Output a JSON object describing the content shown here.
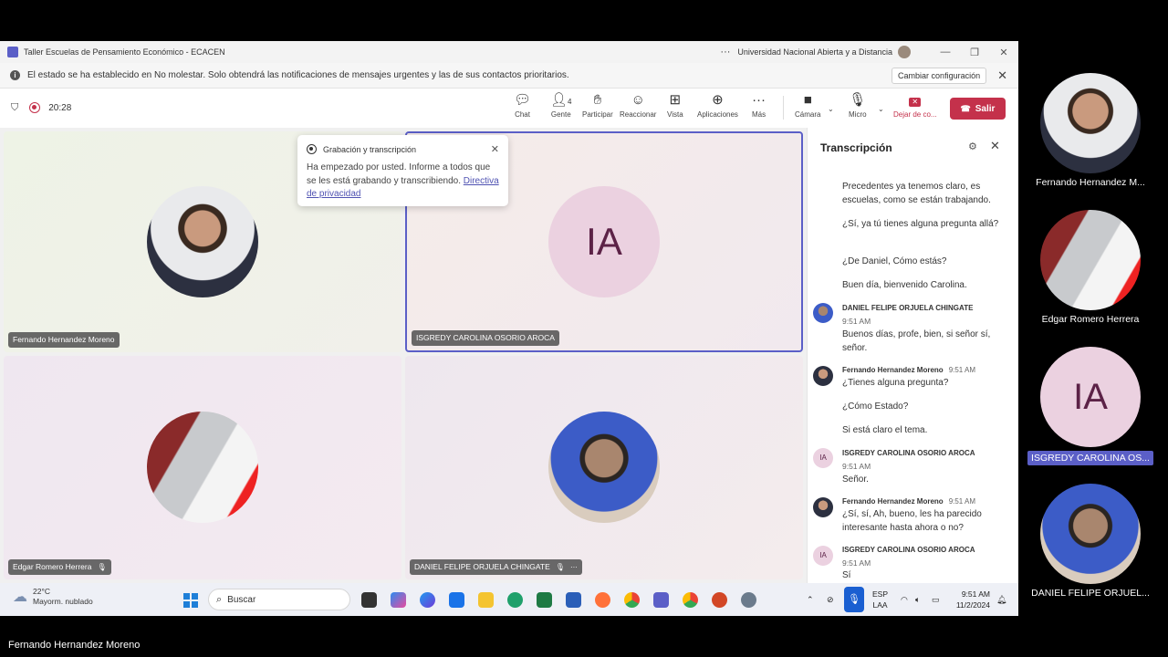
{
  "window": {
    "title": "Taller Escuelas de Pensamiento Económico - ECACEN",
    "org": "Universidad Nacional Abierta y a Distancia",
    "more": "···",
    "min": "—",
    "restore": "❐",
    "close": "✕"
  },
  "banner": {
    "message": "El estado se ha establecido en No molestar. Solo obtendrá las notificaciones de mensajes urgentes y las de sus contactos prioritarios.",
    "change_button": "Cambiar configuración",
    "close": "✕"
  },
  "toolbar": {
    "timer": "20:28",
    "chat": "Chat",
    "people": "Gente",
    "people_count": "4",
    "raise": "Participar",
    "react": "Reaccionar",
    "view": "Vista",
    "apps": "Aplicaciones",
    "more": "Más",
    "camera": "Cámara",
    "mic": "Micro",
    "share": "Dejar de co...",
    "leave": "Salir"
  },
  "tiles": [
    {
      "name": "Fernando Hernandez Moreno"
    },
    {
      "name": "ISGREDY CAROLINA OSORIO AROCA",
      "initials": "IA"
    },
    {
      "name": "Edgar Romero Herrera"
    },
    {
      "name": "DANIEL FELIPE ORJUELA CHINGATE"
    }
  ],
  "popup": {
    "title": "Grabación y transcripción",
    "body": "Ha empezado por usted. Informe a todos que se les está grabando y transcribiendo.",
    "link": "Directiva de privacidad"
  },
  "transcript": {
    "title": "Transcripción",
    "lines": [
      {
        "text": "Precedentes ya tenemos claro, es escuelas, como se están trabajando."
      },
      {
        "text": "¿Sí, ya tú tienes alguna pregunta allá?"
      },
      {
        "text": "¿De Daniel, Cómo estás?"
      },
      {
        "text": "Buen día, bienvenido Carolina."
      }
    ],
    "entries": [
      {
        "speaker": "DANIEL FELIPE ORJUELA CHINGATE",
        "time": "9:51 AM",
        "text": "Buenos días, profe, bien, si señor sí, señor."
      },
      {
        "speaker": "Fernando Hernandez Moreno",
        "time": "9:51 AM",
        "text": "¿Tienes alguna pregunta?",
        "extra1": "¿Cómo Estado?",
        "extra2": "Si está claro el tema."
      },
      {
        "speaker": "ISGREDY CAROLINA OSORIO AROCA",
        "time": "9:51 AM",
        "text": "Señor.",
        "initials": "IA"
      },
      {
        "speaker": "Fernando Hernandez Moreno",
        "time": "9:51 AM",
        "text": "¿Sí, sí, Ah, bueno, les ha parecido interesante hasta ahora o no?"
      },
      {
        "speaker": "ISGREDY CAROLINA OSORIO AROCA",
        "time": "9:51 AM",
        "text": "Sí",
        "initials": "IA"
      }
    ]
  },
  "taskbar": {
    "temp": "22°C",
    "weather": "Mayorm. nublado",
    "search": "Buscar",
    "lang1": "ESP",
    "lang2": "LAA",
    "time": "9:51 AM",
    "date": "11/2/2024"
  },
  "side": [
    {
      "name": "Fernando Hernandez M..."
    },
    {
      "name": "Edgar Romero Herrera"
    },
    {
      "name": "ISGREDY CAROLINA  OS...",
      "initials": "IA"
    },
    {
      "name": "DANIEL FELIPE ORJUEL..."
    }
  ],
  "bottom_name": "Fernando Hernandez Moreno",
  "colors": {
    "accent": "#5b5fc7",
    "leave": "#c4314b",
    "ia_bg": "#ebd1e0",
    "ia_fg": "#5c2247"
  }
}
